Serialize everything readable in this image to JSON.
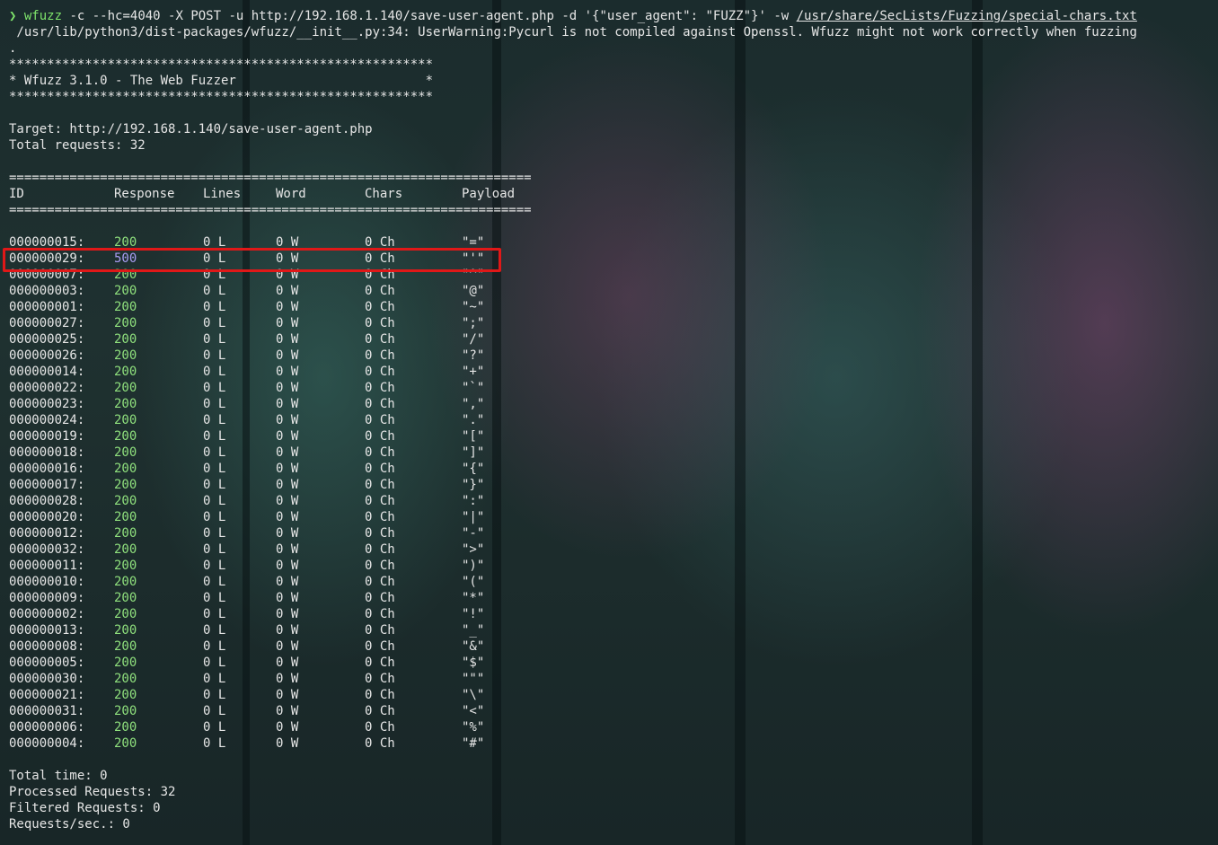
{
  "command": {
    "prompt_symbol": "❯",
    "program": "wfuzz",
    "args_before_wordlist": " -c --hc=4040 -X POST -u http://192.168.1.140/save-user-agent.php -d '{\"user_agent\": \"FUZZ\"}' -w ",
    "wordlist": "/usr/share/SecLists/Fuzzing/special-chars.txt"
  },
  "warning": {
    "line1": " /usr/lib/python3/dist-packages/wfuzz/__init__.py:34: UserWarning:Pycurl is not compiled against Openssl. Wfuzz might not work correctly when fuzzing",
    "line2": "."
  },
  "banner": {
    "stars": "********************************************************",
    "title": "* Wfuzz 3.1.0 - The Web Fuzzer                         *"
  },
  "target_line": "Target: http://192.168.1.140/save-user-agent.php",
  "total_requests_line": "Total requests: 32",
  "separator": "=====================================================================",
  "headers": {
    "id": "ID",
    "response": "Response",
    "lines": "Lines",
    "word": "Word",
    "chars": "Chars",
    "payload": "Payload"
  },
  "results": [
    {
      "id": "000000015:",
      "response": "200",
      "lines": "0 L",
      "word": "0 W",
      "chars": "0 Ch",
      "payload": "\"=\""
    },
    {
      "id": "000000029:",
      "response": "500",
      "lines": "0 L",
      "word": "0 W",
      "chars": "0 Ch",
      "payload": "\"'\""
    },
    {
      "id": "000000007:",
      "response": "200",
      "lines": "0 L",
      "word": "0 W",
      "chars": "0 Ch",
      "payload": "\"^\""
    },
    {
      "id": "000000003:",
      "response": "200",
      "lines": "0 L",
      "word": "0 W",
      "chars": "0 Ch",
      "payload": "\"@\""
    },
    {
      "id": "000000001:",
      "response": "200",
      "lines": "0 L",
      "word": "0 W",
      "chars": "0 Ch",
      "payload": "\"~\""
    },
    {
      "id": "000000027:",
      "response": "200",
      "lines": "0 L",
      "word": "0 W",
      "chars": "0 Ch",
      "payload": "\";\""
    },
    {
      "id": "000000025:",
      "response": "200",
      "lines": "0 L",
      "word": "0 W",
      "chars": "0 Ch",
      "payload": "\"/\""
    },
    {
      "id": "000000026:",
      "response": "200",
      "lines": "0 L",
      "word": "0 W",
      "chars": "0 Ch",
      "payload": "\"?\""
    },
    {
      "id": "000000014:",
      "response": "200",
      "lines": "0 L",
      "word": "0 W",
      "chars": "0 Ch",
      "payload": "\"+\""
    },
    {
      "id": "000000022:",
      "response": "200",
      "lines": "0 L",
      "word": "0 W",
      "chars": "0 Ch",
      "payload": "\"`\""
    },
    {
      "id": "000000023:",
      "response": "200",
      "lines": "0 L",
      "word": "0 W",
      "chars": "0 Ch",
      "payload": "\",\""
    },
    {
      "id": "000000024:",
      "response": "200",
      "lines": "0 L",
      "word": "0 W",
      "chars": "0 Ch",
      "payload": "\".\""
    },
    {
      "id": "000000019:",
      "response": "200",
      "lines": "0 L",
      "word": "0 W",
      "chars": "0 Ch",
      "payload": "\"[\""
    },
    {
      "id": "000000018:",
      "response": "200",
      "lines": "0 L",
      "word": "0 W",
      "chars": "0 Ch",
      "payload": "\"]\""
    },
    {
      "id": "000000016:",
      "response": "200",
      "lines": "0 L",
      "word": "0 W",
      "chars": "0 Ch",
      "payload": "\"{\""
    },
    {
      "id": "000000017:",
      "response": "200",
      "lines": "0 L",
      "word": "0 W",
      "chars": "0 Ch",
      "payload": "\"}\""
    },
    {
      "id": "000000028:",
      "response": "200",
      "lines": "0 L",
      "word": "0 W",
      "chars": "0 Ch",
      "payload": "\":\""
    },
    {
      "id": "000000020:",
      "response": "200",
      "lines": "0 L",
      "word": "0 W",
      "chars": "0 Ch",
      "payload": "\"|\""
    },
    {
      "id": "000000012:",
      "response": "200",
      "lines": "0 L",
      "word": "0 W",
      "chars": "0 Ch",
      "payload": "\"-\""
    },
    {
      "id": "000000032:",
      "response": "200",
      "lines": "0 L",
      "word": "0 W",
      "chars": "0 Ch",
      "payload": "\">\""
    },
    {
      "id": "000000011:",
      "response": "200",
      "lines": "0 L",
      "word": "0 W",
      "chars": "0 Ch",
      "payload": "\")\""
    },
    {
      "id": "000000010:",
      "response": "200",
      "lines": "0 L",
      "word": "0 W",
      "chars": "0 Ch",
      "payload": "\"(\""
    },
    {
      "id": "000000009:",
      "response": "200",
      "lines": "0 L",
      "word": "0 W",
      "chars": "0 Ch",
      "payload": "\"*\""
    },
    {
      "id": "000000002:",
      "response": "200",
      "lines": "0 L",
      "word": "0 W",
      "chars": "0 Ch",
      "payload": "\"!\""
    },
    {
      "id": "000000013:",
      "response": "200",
      "lines": "0 L",
      "word": "0 W",
      "chars": "0 Ch",
      "payload": "\"_\""
    },
    {
      "id": "000000008:",
      "response": "200",
      "lines": "0 L",
      "word": "0 W",
      "chars": "0 Ch",
      "payload": "\"&\""
    },
    {
      "id": "000000005:",
      "response": "200",
      "lines": "0 L",
      "word": "0 W",
      "chars": "0 Ch",
      "payload": "\"$\""
    },
    {
      "id": "000000030:",
      "response": "200",
      "lines": "0 L",
      "word": "0 W",
      "chars": "0 Ch",
      "payload": "\"\"\""
    },
    {
      "id": "000000021:",
      "response": "200",
      "lines": "0 L",
      "word": "0 W",
      "chars": "0 Ch",
      "payload": "\"\\\""
    },
    {
      "id": "000000031:",
      "response": "200",
      "lines": "0 L",
      "word": "0 W",
      "chars": "0 Ch",
      "payload": "\"<\""
    },
    {
      "id": "000000006:",
      "response": "200",
      "lines": "0 L",
      "word": "0 W",
      "chars": "0 Ch",
      "payload": "\"%\""
    },
    {
      "id": "000000004:",
      "response": "200",
      "lines": "0 L",
      "word": "0 W",
      "chars": "0 Ch",
      "payload": "\"#\""
    }
  ],
  "summary": {
    "total_time": "Total time: 0",
    "processed": "Processed Requests: 32",
    "filtered": "Filtered Requests: 0",
    "rate": "Requests/sec.: 0"
  },
  "colors": {
    "status_ok": "#8fe07d",
    "status_error": "#a99cf2",
    "highlight_box": "#e01818",
    "prompt": "#7ee36b"
  }
}
